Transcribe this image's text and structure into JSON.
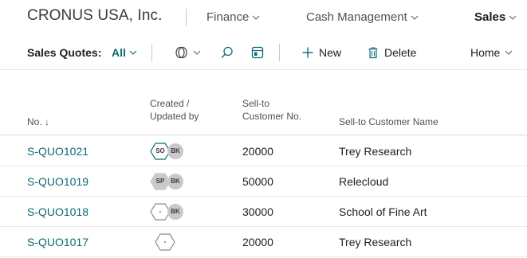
{
  "header": {
    "company": "CRONUS USA, Inc.",
    "nav": [
      {
        "label": "Finance",
        "active": false
      },
      {
        "label": "Cash Management",
        "active": false
      },
      {
        "label": "Sales",
        "active": true
      }
    ]
  },
  "actionbar": {
    "page_caption": "Sales Quotes:",
    "filter_label": "All",
    "new_label": "New",
    "delete_label": "Delete",
    "home_label": "Home"
  },
  "table": {
    "columns": {
      "no": "No. ↓",
      "created_line1": "Created /",
      "created_line2": "Updated by",
      "sellto_line1": "Sell-to",
      "sellto_line2": "Customer No.",
      "name": "Sell-to Customer Name"
    },
    "rows": [
      {
        "no": "S-QUO1021",
        "created": "SO",
        "updated": "BK",
        "created_style": "hex-outline",
        "customer_no": "20000",
        "customer_name": "Trey Research"
      },
      {
        "no": "S-QUO1019",
        "created": "SP",
        "updated": "BK",
        "created_style": "hex-filled",
        "customer_no": "50000",
        "customer_name": "Relecloud"
      },
      {
        "no": "S-QUO1018",
        "created": "-",
        "updated": "BK",
        "created_style": "hex-outline",
        "customer_no": "30000",
        "customer_name": "School of Fine Art"
      },
      {
        "no": "S-QUO1017",
        "created": "-",
        "updated": "",
        "created_style": "hex-outline",
        "customer_no": "20000",
        "customer_name": "Trey Research"
      }
    ]
  },
  "colors": {
    "accent": "#0b6a73",
    "text": "#212121",
    "muted": "#505050",
    "badge_fill": "#c9c9c9"
  }
}
